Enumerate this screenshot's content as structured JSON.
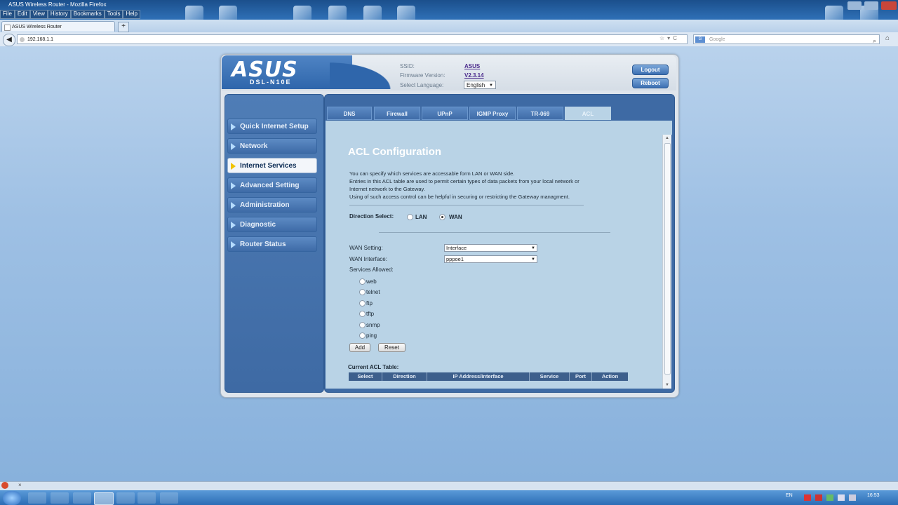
{
  "browser": {
    "window_title": "ASUS Wireless Router - Mozilla Firefox",
    "menu": [
      "File",
      "Edit",
      "View",
      "History",
      "Bookmarks",
      "Tools",
      "Help"
    ],
    "tab_title": "ASUS Wireless Router",
    "new_tab": "+",
    "url": "192.168.1.1",
    "search_placeholder": "Google",
    "search_engine_badge": "G"
  },
  "router": {
    "brand": "ASUS",
    "model": "DSL-N10E",
    "ssid_label": "SSID:",
    "ssid_value": "ASUS",
    "firmware_label": "Firmware Version:",
    "firmware_value": "V2.3.14",
    "language_label": "Select Language:",
    "language_value": "English",
    "logout": "Logout",
    "reboot": "Reboot"
  },
  "sidebar": {
    "items": [
      {
        "label": "Quick Internet Setup"
      },
      {
        "label": "Network"
      },
      {
        "label": "Internet Services"
      },
      {
        "label": "Advanced Setting"
      },
      {
        "label": "Administration"
      },
      {
        "label": "Diagnostic"
      },
      {
        "label": "Router Status"
      }
    ],
    "active": "Internet Services"
  },
  "tabs": [
    {
      "label": "DNS"
    },
    {
      "label": "Firewall"
    },
    {
      "label": "UPnP"
    },
    {
      "label": "IGMP Proxy"
    },
    {
      "label": "TR-069"
    },
    {
      "label": "ACL"
    }
  ],
  "acl": {
    "title": "ACL Configuration",
    "desc1": "You can specify which services are accessable form LAN or WAN side.",
    "desc2": "Entries in this ACL table are used to permit certain types of data packets from your local network or",
    "desc3": "Internet network to the Gateway.",
    "desc4": "Using of such access control can be helpful in securing or restricting the Gateway managment.",
    "direction_label": "Direction Select:",
    "direction_lan": "LAN",
    "direction_wan": "WAN",
    "direction_value": "WAN",
    "wan_setting_label": "WAN Setting:",
    "wan_setting_value": "Interface",
    "wan_interface_label": "WAN Interface:",
    "wan_interface_value": "pppoe1",
    "services_label": "Services Allowed:",
    "services": [
      {
        "name": "web"
      },
      {
        "name": "telnet"
      },
      {
        "name": "ftp"
      },
      {
        "name": "tftp"
      },
      {
        "name": "snmp"
      },
      {
        "name": "ping"
      }
    ],
    "add_button": "Add",
    "reset_button": "Reset",
    "table_title": "Current ACL Table:",
    "table_columns": [
      "Select",
      "Direction",
      "IP Address/Interface",
      "Service",
      "Port",
      "Action"
    ]
  },
  "taskbar": {
    "language": "EN",
    "clock": "16:53"
  }
}
